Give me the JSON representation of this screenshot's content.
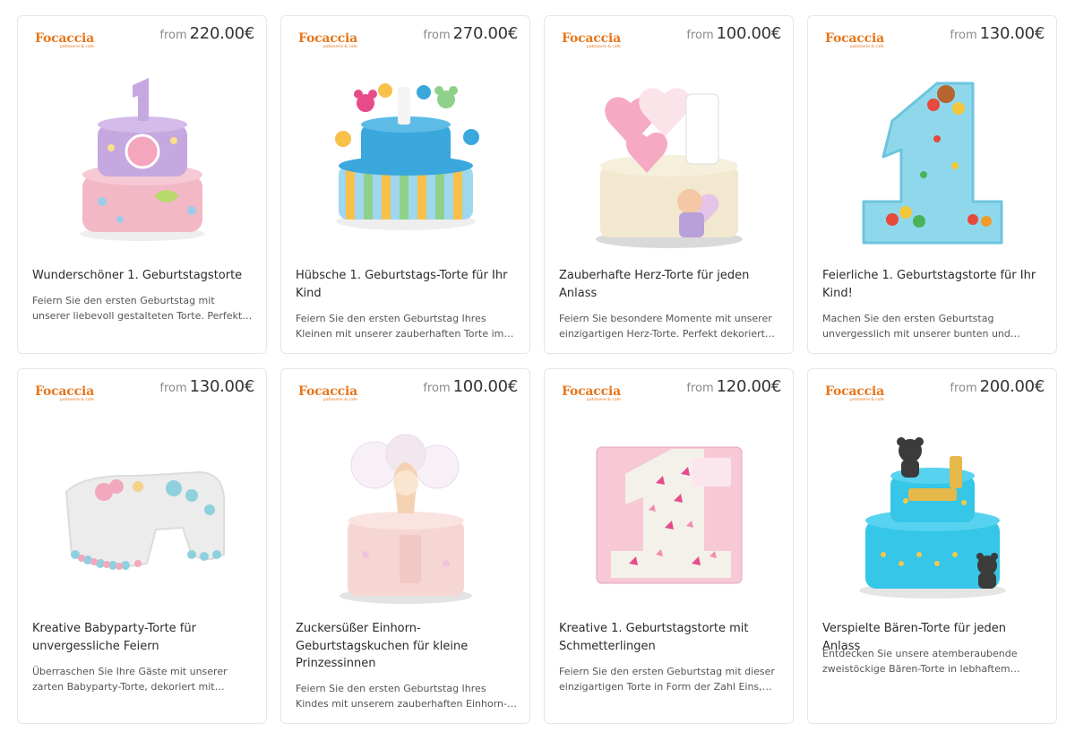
{
  "products": [
    {
      "brand": "Focaccia",
      "brand_sub": "patisserie & cafe",
      "price_prefix": "from",
      "price": "220.00€",
      "title": "Wunderschöner 1. Geburtstagstorte",
      "description": "Feiern Sie den ersten Geburtstag mit unserer liebevoll gestalteten Torte. Perfekt für…",
      "image_icon": "purple-pink-birthday-cake-image"
    },
    {
      "brand": "Focaccia",
      "brand_sub": "patisserie & cafe",
      "price_prefix": "from",
      "price": "270.00€",
      "title": "Hübsche 1. Geburtstags-Torte für Ihr Kind",
      "description": "Feiern Sie den ersten Geburtstag Ihres Kleinen mit unserer zauberhaften Torte im Mickey-…",
      "image_icon": "mickey-striped-cake-image"
    },
    {
      "brand": "Focaccia",
      "brand_sub": "patisserie & cafe",
      "price_prefix": "from",
      "price": "100.00€",
      "title": "Zauberhafte Herz-Torte für jeden Anlass",
      "description": "Feiern Sie besondere Momente mit unserer einzigartigen Herz-Torte. Perfekt dekoriert un…",
      "image_icon": "heart-cookie-cake-image"
    },
    {
      "brand": "Focaccia",
      "brand_sub": "patisserie & cafe",
      "price_prefix": "from",
      "price": "130.00€",
      "title": "Feierliche 1. Geburtstagstorte für Ihr Kind!",
      "description": "Machen Sie den ersten Geburtstag unvergesslich mit unserer bunten und…",
      "image_icon": "number-one-blue-cake-image"
    },
    {
      "brand": "Focaccia",
      "brand_sub": "patisserie & cafe",
      "price_prefix": "from",
      "price": "130.00€",
      "title": "Kreative Babyparty-Torte für unvergessliche Feiern",
      "description": "Überraschen Sie Ihre Gäste mit unserer zarten Babyparty-Torte, dekoriert mit liebevollen…",
      "image_icon": "babyparty-shaped-cake-image"
    },
    {
      "brand": "Focaccia",
      "brand_sub": "patisserie & cafe",
      "price_prefix": "from",
      "price": "100.00€",
      "title": "Zuckersüßer Einhorn-Geburtstagskuchen für kleine Prinzessinnen",
      "description": "Feiern Sie den ersten Geburtstag Ihres Kindes mit unserem zauberhaften Einhorn-Kuchen…",
      "image_icon": "unicorn-pink-cake-image"
    },
    {
      "brand": "Focaccia",
      "brand_sub": "patisserie & cafe",
      "price_prefix": "from",
      "price": "120.00€",
      "title": "Kreative 1. Geburtstagstorte mit Schmetterlingen",
      "description": "Feiern Sie den ersten Geburtstag mit dieser einzigartigen Torte in Form der Zahl Eins,…",
      "image_icon": "butterfly-number-one-cake-image"
    },
    {
      "brand": "Focaccia",
      "brand_sub": "patisserie & cafe",
      "price_prefix": "from",
      "price": "200.00€",
      "title": "Verspielte Bären-Torte für jeden Anlass",
      "description": "Entdecken Sie unsere atemberaubende zweistöckige Bären-Torte in lebhaftem Blau…",
      "image_icon": "blue-bear-cake-image"
    }
  ],
  "colors": {
    "brand_orange": "#e6761c",
    "card_border": "#e6e6e6",
    "price_prefix": "#8a8a8a"
  }
}
